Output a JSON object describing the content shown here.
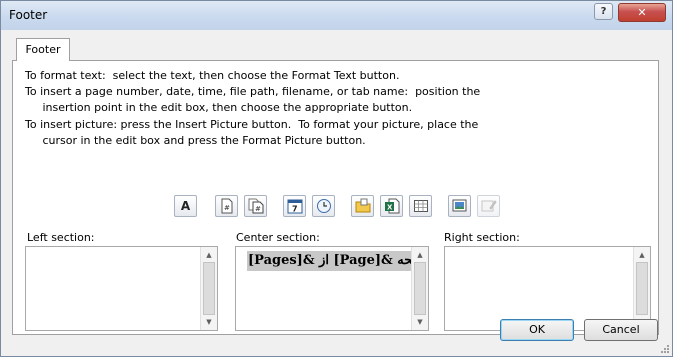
{
  "window": {
    "title": "Footer",
    "help_glyph": "?",
    "close_glyph": "✕"
  },
  "tabs": [
    {
      "label": "Footer"
    }
  ],
  "instructions": [
    "To format text:  select the text, then choose the Format Text button.",
    "To insert a page number, date, time, file path, filename, or tab name:  position the",
    "     insertion point in the edit box, then choose the appropriate button.",
    "To insert picture: press the Insert Picture button.  To format your picture, place the",
    "     cursor in the edit box and press the Format Picture button."
  ],
  "toolbar": [
    {
      "icon": "format-text-icon",
      "glyph": "A"
    },
    {
      "icon": "page-number-icon",
      "glyph": "#"
    },
    {
      "icon": "number-of-pages-icon",
      "glyph": "#"
    },
    {
      "icon": "current-date-icon",
      "glyph": "7"
    },
    {
      "icon": "current-time-icon",
      "glyph": "◷"
    },
    {
      "icon": "file-path-icon",
      "glyph": ""
    },
    {
      "icon": "file-name-icon",
      "glyph": "X"
    },
    {
      "icon": "sheet-name-icon",
      "glyph": ""
    },
    {
      "icon": "insert-picture-icon",
      "glyph": ""
    },
    {
      "icon": "format-picture-icon",
      "glyph": ""
    }
  ],
  "sections": {
    "left": {
      "label": "Left section:",
      "value": ""
    },
    "center": {
      "label": "Center section:",
      "value": "[Pages]& از [Page]& صفحه"
    },
    "right": {
      "label": "Right section:",
      "value": ""
    }
  },
  "buttons": {
    "ok": "OK",
    "cancel": "Cancel"
  }
}
